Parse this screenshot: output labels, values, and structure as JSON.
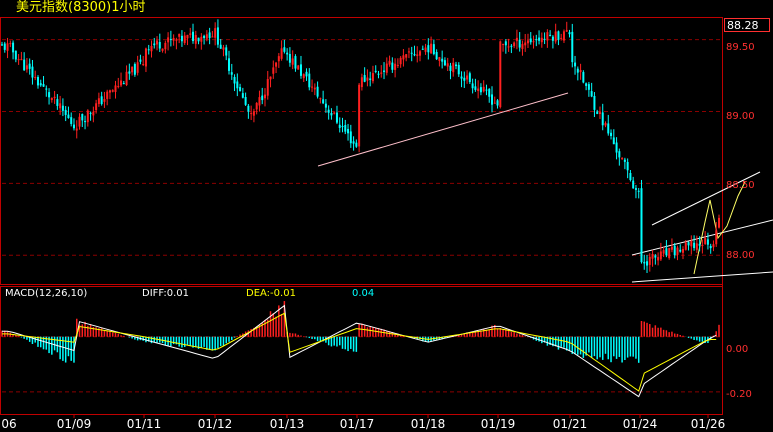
{
  "header": {
    "title": "美元指数(8300)1小时"
  },
  "last_price": "88.28",
  "indicator": {
    "name": "MACD(12,26,10)",
    "diff": "DIFF:0.01",
    "dea": "DEA:-0.01",
    "macd": "0.04"
  },
  "colors": {
    "up": "#ff2020",
    "down": "#00ffff",
    "frame": "#c00000",
    "grid": "#8b0000",
    "diff_line": "#ffffff",
    "dea_line": "#ffff00",
    "trend_line": "#ffc0cb"
  },
  "chart_data": [
    {
      "type": "candlestick",
      "title": "美元指数(8300)1小时",
      "x_tick_labels": [
        "06",
        "01/09",
        "01/11",
        "01/12",
        "01/13",
        "01/17",
        "01/18",
        "01/19",
        "01/21",
        "01/24",
        "01/26"
      ],
      "y_tick_labels": [
        "89.50",
        "89.00",
        "88.50",
        "88.00"
      ],
      "ylim": [
        87.8,
        89.65
      ],
      "grid": true,
      "last_value": 88.28,
      "close_path": [
        {
          "x": "06",
          "y": 89.45
        },
        {
          "x": "01/09",
          "y": 88.9
        },
        {
          "x": "01/09",
          "y": 89.35
        },
        {
          "x": "01/11",
          "y": 89.45
        },
        {
          "x": "01/12",
          "y": 89.55
        },
        {
          "x": "01/12",
          "y": 88.95
        },
        {
          "x": "01/12",
          "y": 89.48
        },
        {
          "x": "01/13",
          "y": 89.4
        },
        {
          "x": "01/13",
          "y": 88.75
        },
        {
          "x": "01/17",
          "y": 89.2
        },
        {
          "x": "01/18",
          "y": 89.45
        },
        {
          "x": "01/18",
          "y": 89.05
        },
        {
          "x": "01/19",
          "y": 89.45
        },
        {
          "x": "01/19",
          "y": 89.55
        },
        {
          "x": "01/21",
          "y": 89.4
        },
        {
          "x": "01/21",
          "y": 88.9
        },
        {
          "x": "01/21",
          "y": 88.4
        },
        {
          "x": "01/24",
          "y": 87.95
        },
        {
          "x": "01/24",
          "y": 88.1
        },
        {
          "x": "01/26",
          "y": 87.95
        },
        {
          "x": "01/26",
          "y": 88.28
        }
      ]
    },
    {
      "type": "bar",
      "title": "MACD(12,26,10)",
      "y_tick_labels": [
        "0.00",
        "-0.20"
      ],
      "ylim": [
        -0.28,
        0.18
      ],
      "series": [
        {
          "name": "DIFF",
          "last": 0.01
        },
        {
          "name": "DEA",
          "last": -0.01
        },
        {
          "name": "MACD",
          "last": 0.04
        }
      ],
      "histogram": [
        {
          "x": "06",
          "y": 0.02
        },
        {
          "x": "06",
          "y": -0.1
        },
        {
          "x": "01/09",
          "y": 0.06
        },
        {
          "x": "01/11",
          "y": -0.02
        },
        {
          "x": "01/12",
          "y": -0.05
        },
        {
          "x": "01/12",
          "y": 0.12
        },
        {
          "x": "01/13",
          "y": 0.02
        },
        {
          "x": "01/13",
          "y": -0.06
        },
        {
          "x": "01/17",
          "y": 0.05
        },
        {
          "x": "01/18",
          "y": -0.02
        },
        {
          "x": "01/19",
          "y": 0.04
        },
        {
          "x": "01/21",
          "y": -0.06
        },
        {
          "x": "01/21",
          "y": -0.1
        },
        {
          "x": "01/24",
          "y": 0.06
        },
        {
          "x": "01/26",
          "y": -0.03
        },
        {
          "x": "01/26",
          "y": 0.04
        }
      ],
      "diff_path": [
        {
          "x": "06",
          "y": 0.02
        },
        {
          "x": "06",
          "y": -0.05
        },
        {
          "x": "01/09",
          "y": 0.06
        },
        {
          "x": "01/11",
          "y": -0.01
        },
        {
          "x": "01/12",
          "y": -0.08
        },
        {
          "x": "01/12",
          "y": 0.12
        },
        {
          "x": "01/13",
          "y": -0.08
        },
        {
          "x": "01/17",
          "y": 0.05
        },
        {
          "x": "01/18",
          "y": -0.02
        },
        {
          "x": "01/19",
          "y": 0.04
        },
        {
          "x": "01/21",
          "y": -0.05
        },
        {
          "x": "01/21",
          "y": -0.22
        },
        {
          "x": "01/24",
          "y": -0.18
        },
        {
          "x": "01/26",
          "y": -0.01
        },
        {
          "x": "01/26",
          "y": 0.01
        }
      ],
      "dea_path": [
        {
          "x": "06",
          "y": 0.01
        },
        {
          "x": "06",
          "y": -0.02
        },
        {
          "x": "01/09",
          "y": 0.04
        },
        {
          "x": "01/11",
          "y": 0.0
        },
        {
          "x": "01/12",
          "y": -0.05
        },
        {
          "x": "01/12",
          "y": 0.09
        },
        {
          "x": "01/13",
          "y": -0.06
        },
        {
          "x": "01/17",
          "y": 0.03
        },
        {
          "x": "01/18",
          "y": -0.01
        },
        {
          "x": "01/19",
          "y": 0.03
        },
        {
          "x": "01/21",
          "y": -0.02
        },
        {
          "x": "01/21",
          "y": -0.2
        },
        {
          "x": "01/24",
          "y": -0.14
        },
        {
          "x": "01/26",
          "y": -0.01
        },
        {
          "x": "01/26",
          "y": -0.01
        }
      ]
    }
  ]
}
